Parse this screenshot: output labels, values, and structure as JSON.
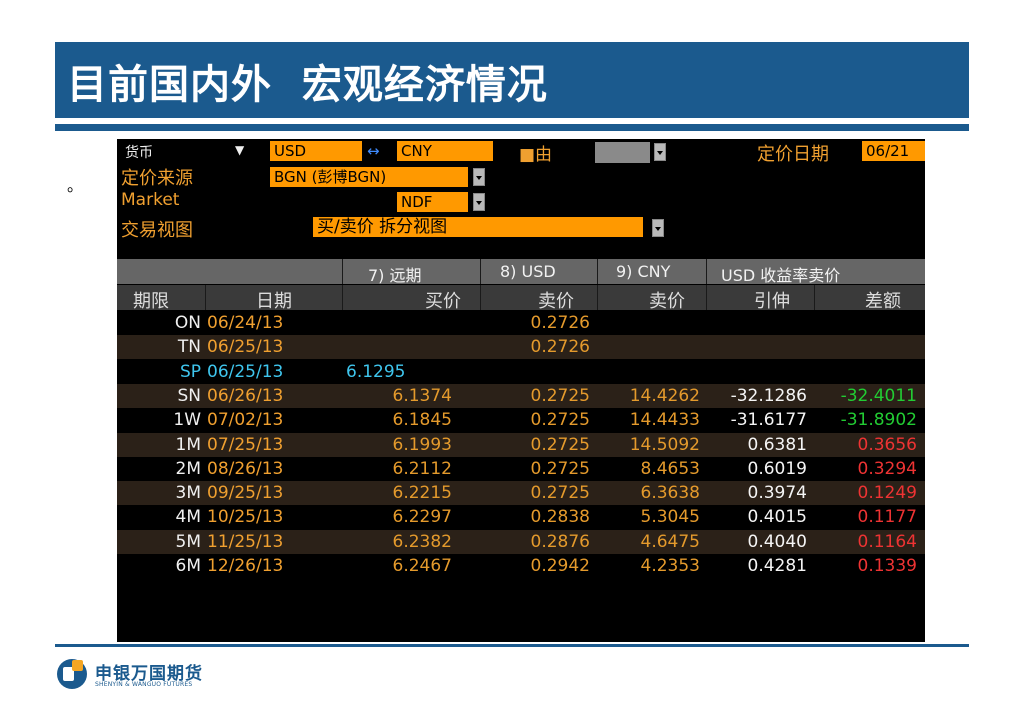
{
  "slide": {
    "title": "目前国内外  宏观经济情况",
    "bullet": "。"
  },
  "terminal": {
    "currency_label": "货币",
    "currency_arrow": "▼",
    "base_ccy": "USD",
    "swap_icon": "↔",
    "quote_ccy": "CNY",
    "from_label": "■由",
    "price_date_label": "定价日期",
    "price_date_value": "06/21",
    "source_label": "定价来源",
    "source_value": "BGN (彭博BGN)",
    "market_label": "Market",
    "market_value": "NDF",
    "view_label": "交易视图",
    "view_value": "买/卖价 拆分视图"
  },
  "table": {
    "group_headers": [
      "7) 远期",
      "8) USD",
      "9) CNY",
      "USD 收益率卖价"
    ],
    "sub_headers": [
      "期限",
      "日期",
      "买价",
      "卖价",
      "卖价",
      "引伸",
      "差额"
    ],
    "rows": [
      {
        "tenor": "ON",
        "date": "06/24/13",
        "bid": "",
        "usd": "0.2726",
        "cny": "",
        "implied": "",
        "spread": ""
      },
      {
        "tenor": "TN",
        "date": "06/25/13",
        "bid": "",
        "usd": "0.2726",
        "cny": "",
        "implied": "",
        "spread": ""
      },
      {
        "tenor": "SP",
        "date": "06/25/13",
        "bid": "6.1295",
        "usd": "",
        "cny": "",
        "implied": "",
        "spread": ""
      },
      {
        "tenor": "SN",
        "date": "06/26/13",
        "bid": "6.1374",
        "usd": "0.2725",
        "cny": "14.4262",
        "implied": "-32.1286",
        "spread": "-32.4011"
      },
      {
        "tenor": "1W",
        "date": "07/02/13",
        "bid": "6.1845",
        "usd": "0.2725",
        "cny": "14.4433",
        "implied": "-31.6177",
        "spread": "-31.8902"
      },
      {
        "tenor": "1M",
        "date": "07/25/13",
        "bid": "6.1993",
        "usd": "0.2725",
        "cny": "14.5092",
        "implied": "0.6381",
        "spread": "0.3656"
      },
      {
        "tenor": "2M",
        "date": "08/26/13",
        "bid": "6.2112",
        "usd": "0.2725",
        "cny": "8.4653",
        "implied": "0.6019",
        "spread": "0.3294"
      },
      {
        "tenor": "3M",
        "date": "09/25/13",
        "bid": "6.2215",
        "usd": "0.2725",
        "cny": "6.3638",
        "implied": "0.3974",
        "spread": "0.1249"
      },
      {
        "tenor": "4M",
        "date": "10/25/13",
        "bid": "6.2297",
        "usd": "0.2838",
        "cny": "5.3045",
        "implied": "0.4015",
        "spread": "0.1177"
      },
      {
        "tenor": "5M",
        "date": "11/25/13",
        "bid": "6.2382",
        "usd": "0.2876",
        "cny": "4.6475",
        "implied": "0.4040",
        "spread": "0.1164"
      },
      {
        "tenor": "6M",
        "date": "12/26/13",
        "bid": "6.2467",
        "usd": "0.2942",
        "cny": "4.2353",
        "implied": "0.4281",
        "spread": "0.1339"
      }
    ]
  },
  "logo": {
    "cn": "申银万国期货",
    "en": "SHENYIN & WANGUO FUTURES"
  },
  "colors": {
    "brand_blue": "#1b5a8e",
    "bloomberg_orange": "#ff9900",
    "negative_green": "#22cc33",
    "positive_red": "#ee3333",
    "spot_cyan": "#3fc6ee"
  }
}
